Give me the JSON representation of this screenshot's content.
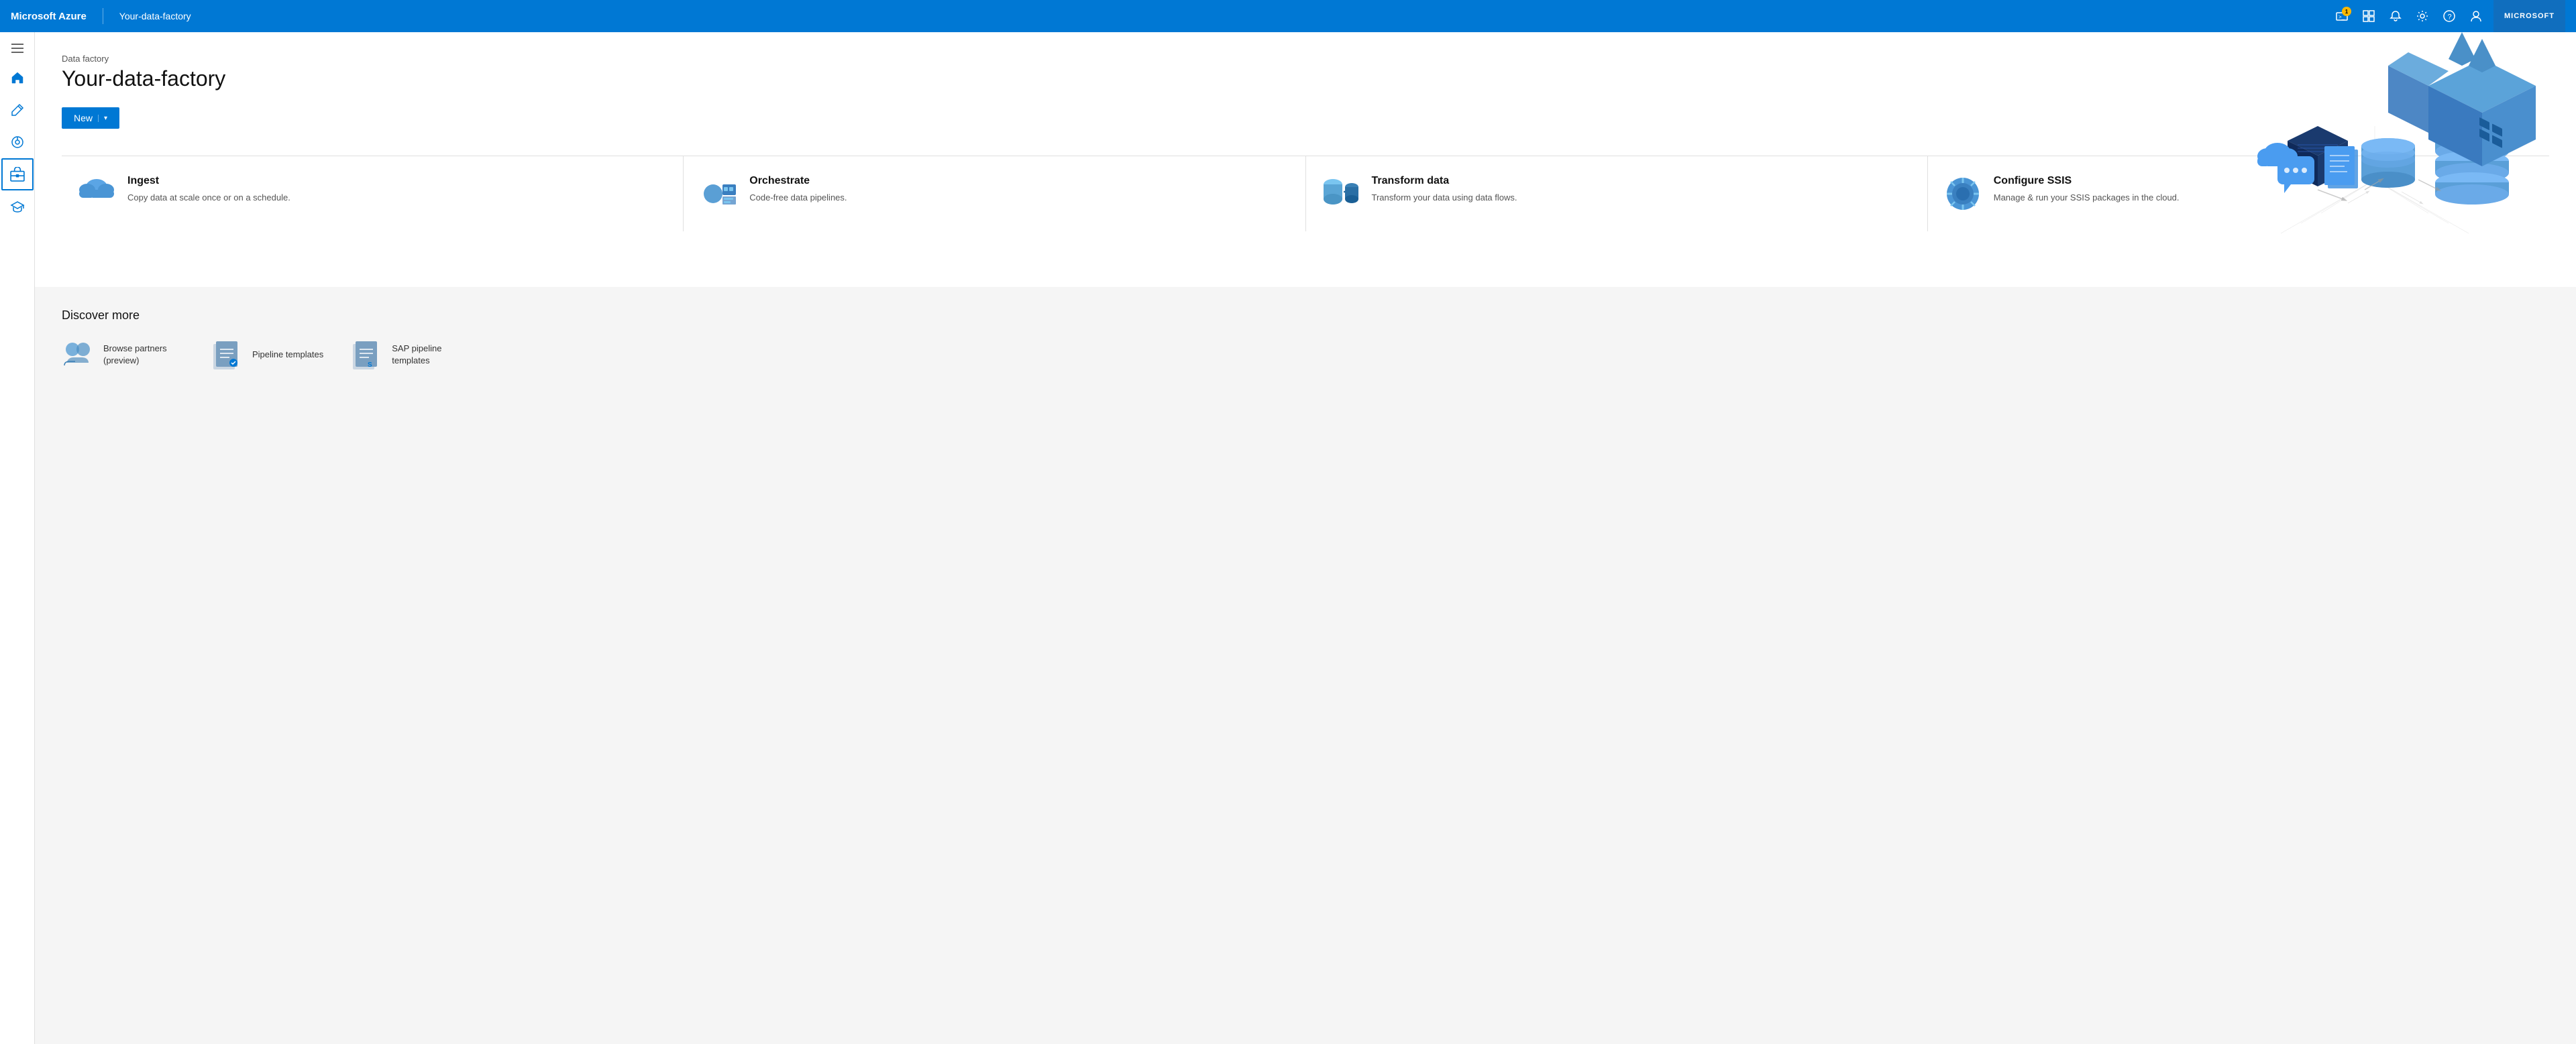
{
  "app": {
    "brand": "Microsoft Azure",
    "resource_name": "Your-data-factory",
    "account_label": "MICROSOFT"
  },
  "topnav": {
    "icons": [
      {
        "name": "cloud-shell-icon",
        "unicode": "⚡",
        "badge": "1"
      },
      {
        "name": "directory-icon",
        "unicode": "⊞",
        "badge": null
      },
      {
        "name": "bell-icon",
        "unicode": "🔔",
        "badge": null
      },
      {
        "name": "settings-icon",
        "unicode": "⚙",
        "badge": null
      },
      {
        "name": "help-icon",
        "unicode": "?",
        "badge": null
      },
      {
        "name": "user-icon",
        "unicode": "👤",
        "badge": null
      }
    ]
  },
  "sidebar": {
    "toggle_icon": "≡",
    "items": [
      {
        "name": "home",
        "label": "Home",
        "active": false
      },
      {
        "name": "author",
        "label": "Author",
        "active": false
      },
      {
        "name": "monitor",
        "label": "Monitor",
        "active": false
      },
      {
        "name": "manage",
        "label": "Manage",
        "active": true
      },
      {
        "name": "learn",
        "label": "Learn",
        "active": false
      }
    ]
  },
  "hero": {
    "subtitle": "Data factory",
    "title": "Your-data-factory",
    "new_button": "New",
    "chevron": "▾"
  },
  "feature_cards": [
    {
      "id": "ingest",
      "title": "Ingest",
      "description": "Copy data at scale once or on a schedule."
    },
    {
      "id": "orchestrate",
      "title": "Orchestrate",
      "description": "Code-free data pipelines."
    },
    {
      "id": "transform",
      "title": "Transform data",
      "description": "Transform your data using data flows."
    },
    {
      "id": "configure-ssis",
      "title": "Configure SSIS",
      "description": "Manage & run your SSIS packages in the cloud."
    }
  ],
  "discover": {
    "title": "Discover more",
    "items": [
      {
        "id": "browse-partners",
        "label": "Browse partners (preview)"
      },
      {
        "id": "pipeline-templates",
        "label": "Pipeline templates"
      },
      {
        "id": "sap-pipeline-templates",
        "label": "SAP pipeline templates"
      }
    ]
  }
}
